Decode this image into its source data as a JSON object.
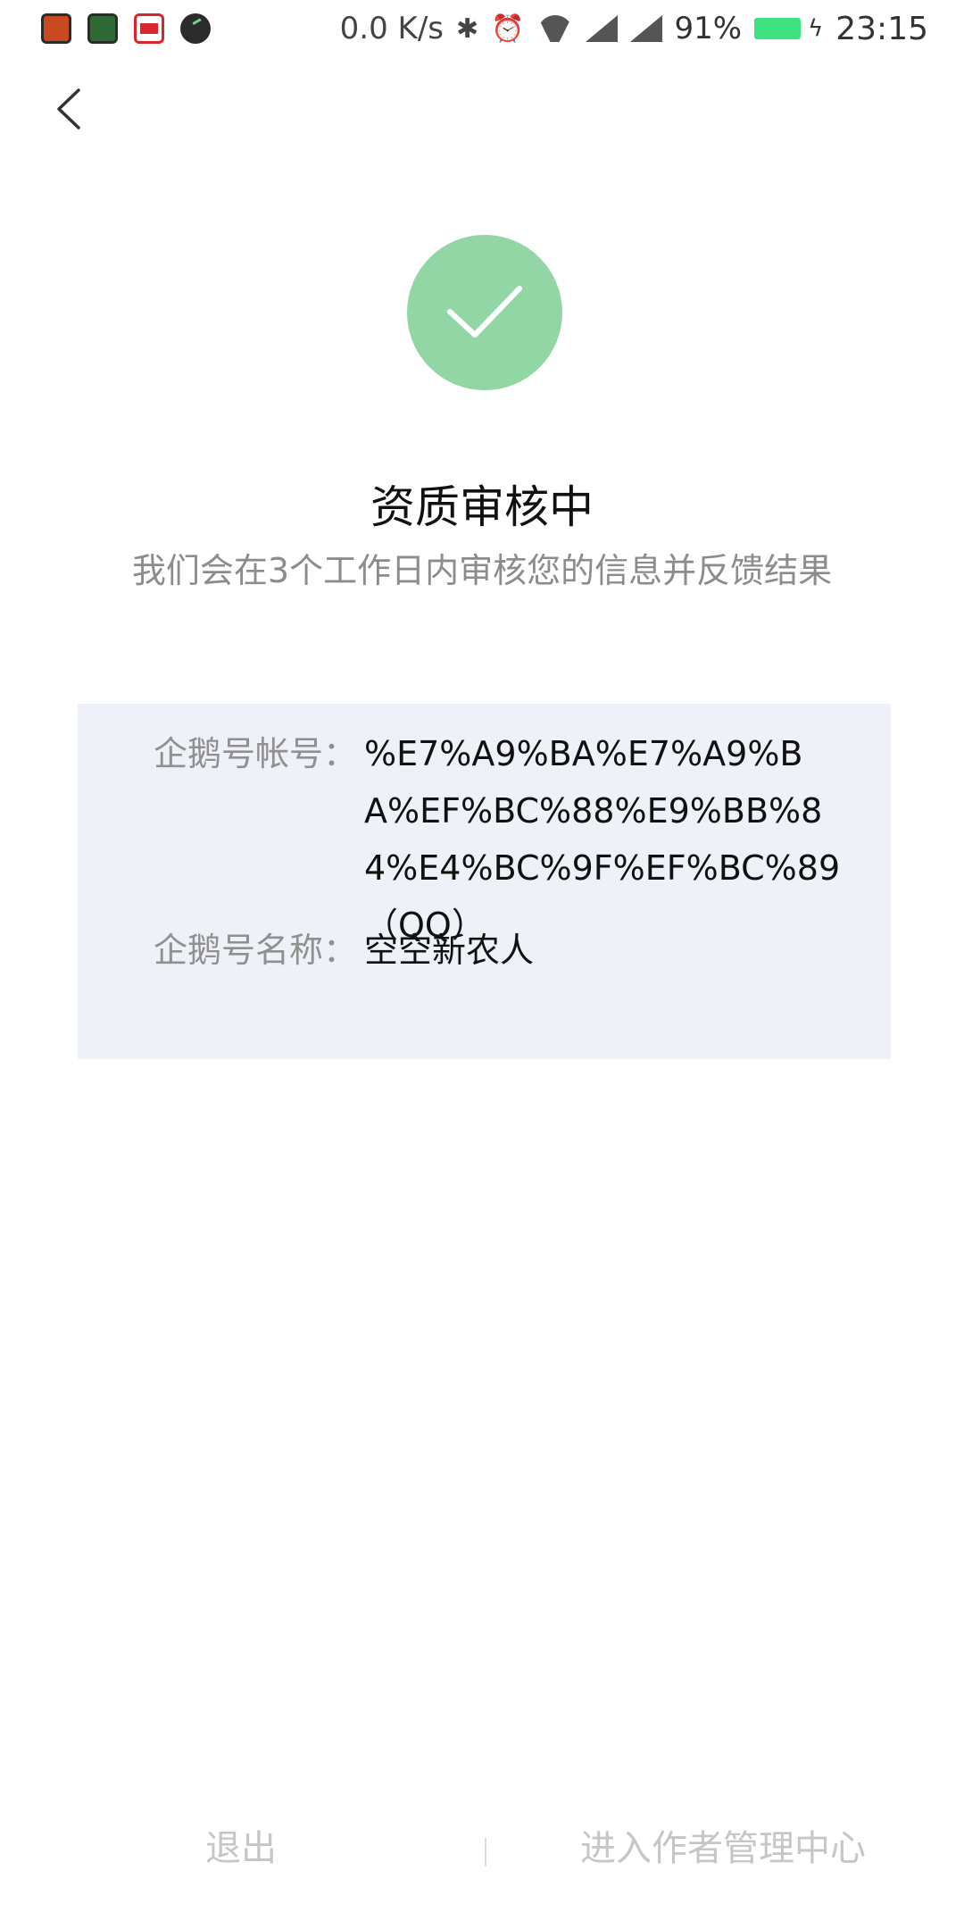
{
  "status_bar": {
    "net_speed": "0.0 K/s",
    "battery_percent": "91%",
    "time": "23:15",
    "icons": [
      "app-icon-1",
      "app-icon-2",
      "toutiao-icon",
      "app-icon-4",
      "bluetooth-icon",
      "alarm-icon",
      "wifi-icon",
      "signal-icon",
      "signal-icon",
      "battery-icon",
      "charging-icon"
    ]
  },
  "header": {
    "back_icon": "chevron-left-icon"
  },
  "status": {
    "icon": "checkmark-icon",
    "icon_color": "#93d6a5",
    "title": "资质审核中",
    "subtitle": "我们会在3个工作日内审核您的信息并反馈结果"
  },
  "info": {
    "account_label": "企鹅号帐号：",
    "account_value": "%E7%A9%BA%E7%A9%BA%EF%BC%88%E9%BB%84%E4%BC%9F%EF%BC%89（QQ）",
    "name_label": "企鹅号名称：",
    "name_value": "空空新农人"
  },
  "actions": {
    "exit_label": "退出",
    "center_label": "进入作者管理中心"
  }
}
